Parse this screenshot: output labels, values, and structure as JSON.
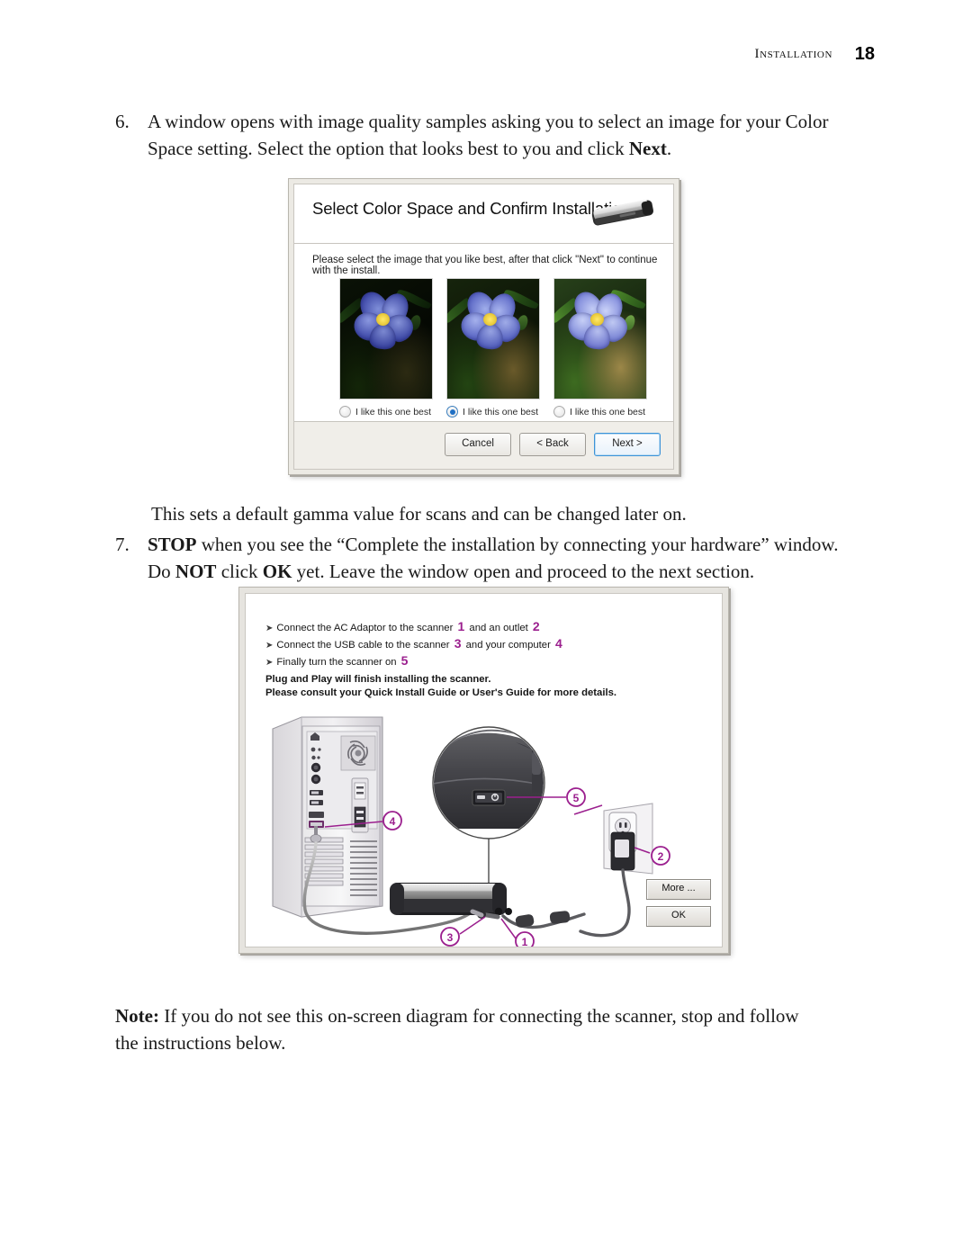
{
  "header": {
    "section": "Installation",
    "page_number": "18"
  },
  "steps": [
    {
      "number": "6.",
      "line1_a": "A window opens with image quality samples asking you to select an image for your Color Space",
      "line2_a": "setting. Select the option that looks best to you and click ",
      "line2_bold": "Next",
      "line2_b": "."
    },
    {
      "number": "7.",
      "bold1": "STOP",
      "t1": " when you see the “Complete the installation by connecting your hardware” window. Do ",
      "bold2": "NOT",
      "t2": "click ",
      "bold3": "OK",
      "t3": " yet. Leave the window open and proceed to the next section."
    }
  ],
  "gamma_note": "This sets a default gamma value for scans and can be changed later on.",
  "bottom_note": {
    "label": "Note:",
    "text": " If you do not see this on-screen diagram for connecting the scanner, stop and follow the instructions below."
  },
  "dialog_color_space": {
    "title": "Select Color Space and Confirm Installation",
    "instruction": "Please select the image that you like best, after that click \"Next\" to continue with the install.",
    "icon": "portable-scanner-icon",
    "samples": [
      {
        "label": "I like this one best",
        "selected": false,
        "gamma": "dark"
      },
      {
        "label": "I like this one best",
        "selected": true,
        "gamma": "medium"
      },
      {
        "label": "I like this one best",
        "selected": false,
        "gamma": "light"
      }
    ],
    "buttons": [
      {
        "label": "Cancel",
        "primary": false
      },
      {
        "label": "< Back",
        "primary": false
      },
      {
        "label": "Next >",
        "primary": true
      }
    ]
  },
  "dialog_connect": {
    "bullets": [
      {
        "pre": "Connect the AC Adaptor to the scanner ",
        "num1": "1",
        "mid": " and an outlet ",
        "num2": "2"
      },
      {
        "pre": "Connect the USB cable to the scanner ",
        "num1": "3",
        "mid": " and your computer ",
        "num2": "4"
      },
      {
        "pre": "Finally turn the scanner on ",
        "num1": "5",
        "mid": "",
        "num2": ""
      }
    ],
    "note_line1": "Plug and Play will finish installing the scanner.",
    "note_line2": "Please consult your Quick Install Guide or User's Guide for more details.",
    "callouts": [
      "1",
      "2",
      "3",
      "4",
      "5"
    ],
    "buttons": [
      {
        "label": "More ..."
      },
      {
        "label": "OK"
      }
    ]
  },
  "colors": {
    "callout_magenta": "#9b1f8e",
    "dialog_face": "#eceae4",
    "primary_button_border": "#3c93d8"
  }
}
